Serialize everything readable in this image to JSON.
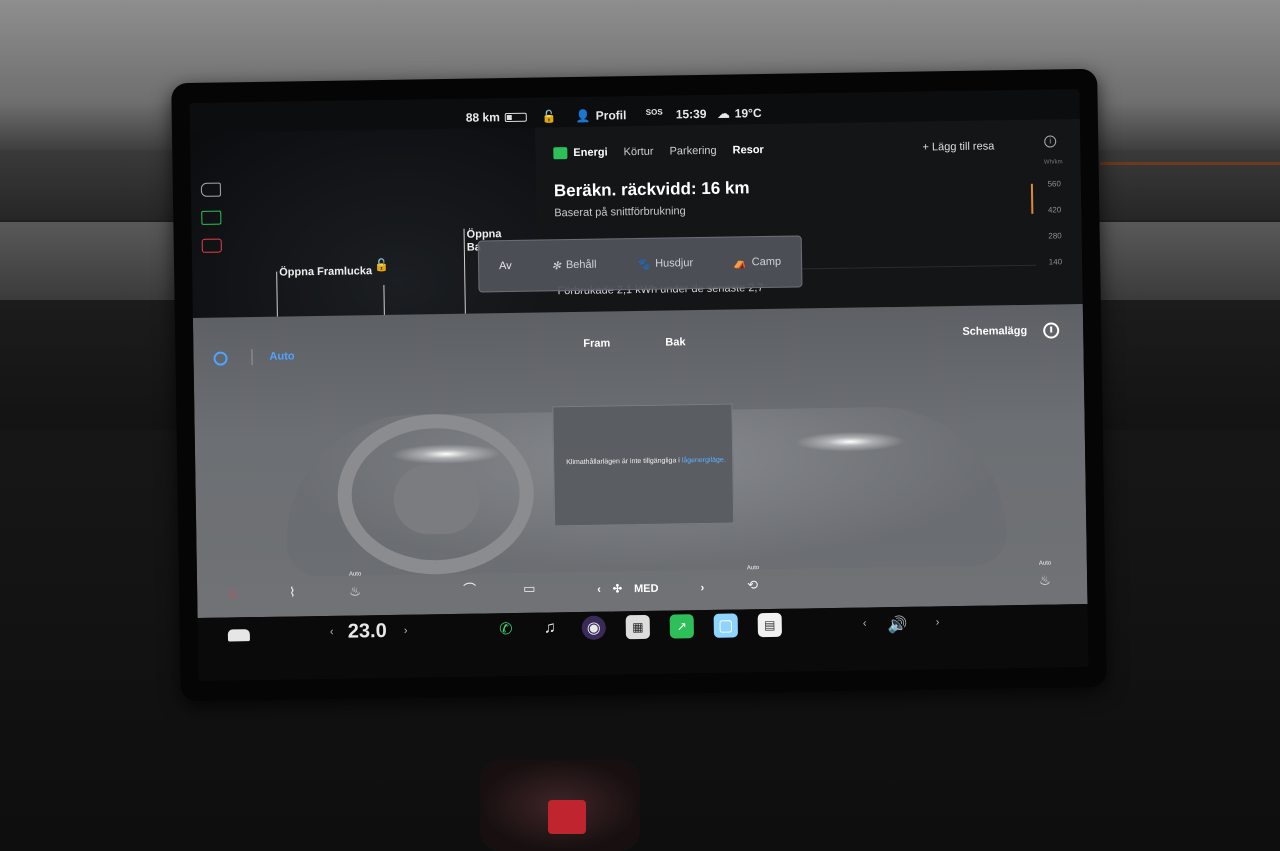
{
  "status": {
    "range": "88 km",
    "profile": "Profil",
    "sos": "SOS",
    "time": "15:39",
    "temp": "19°C"
  },
  "left": {
    "front_trunk": "Öppna Framlucka",
    "rear_trunk": "Öppna Ba"
  },
  "energy": {
    "tabs": [
      "Energi",
      "Körtur",
      "Parkering",
      "Resor"
    ],
    "add_trip": "+ Lägg till resa",
    "range_title": "Beräkn. räckvidd: 16 km",
    "range_sub": "Baserat på snittförbrukning",
    "consumed": "Förbrukade 2,1 kWh under de senaste 2,7",
    "yaxis_title": "Wh/km",
    "yticks": [
      "560",
      "420",
      "280",
      "140"
    ]
  },
  "modes": [
    "Av",
    "Behåll",
    "Husdjur",
    "Camp"
  ],
  "climate": {
    "auto": "Auto",
    "front": "Fram",
    "rear": "Bak",
    "schedule": "Schemalägg",
    "message": "Klimathållarlägen är inte tillgängliga i",
    "message_link": "lågenergiläge.",
    "fan_level": "MED",
    "auto_small": "Auto"
  },
  "dock": {
    "temperature": "23.0"
  },
  "colors": {
    "accent": "#4fa3ff",
    "energy_green": "#2fbf5a",
    "chart_mark": "#e08a2a"
  }
}
